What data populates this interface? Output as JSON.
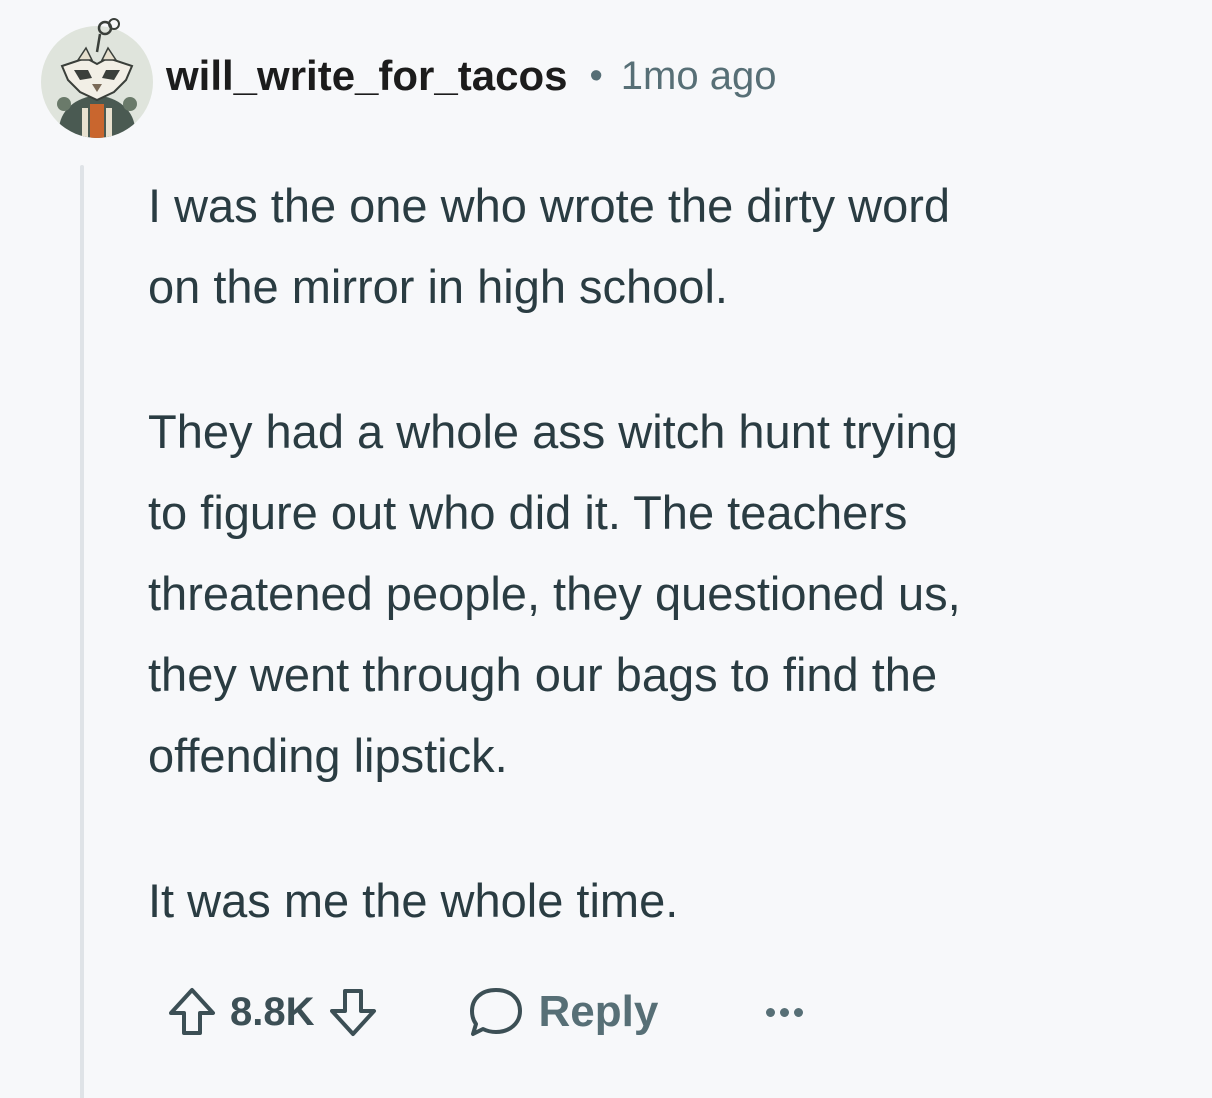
{
  "comment": {
    "author": "will_write_for_tacos",
    "separator": "•",
    "timestamp": "1mo ago",
    "avatar_icon": "snoo-avatar-icon",
    "paragraphs": [
      "I was the one who wrote the dirty word\non the mirror in high school.",
      "They had a whole ass witch hunt trying\nto figure out who did it. The teachers\nthreatened people, they questioned us,\nthey went through our bags to find the\noffending lipstick.",
      "It was me the whole time."
    ]
  },
  "actions": {
    "upvote_icon": "upvote-arrow-icon",
    "score": "8.8K",
    "downvote_icon": "downvote-arrow-icon",
    "reply_icon": "speech-bubble-icon",
    "reply_label": "Reply",
    "more_icon": "ellipsis-icon"
  },
  "colors": {
    "background": "#f7f8fa",
    "text": "#2a3c42",
    "muted": "#576f76",
    "thread_line": "#dfe3e7"
  }
}
